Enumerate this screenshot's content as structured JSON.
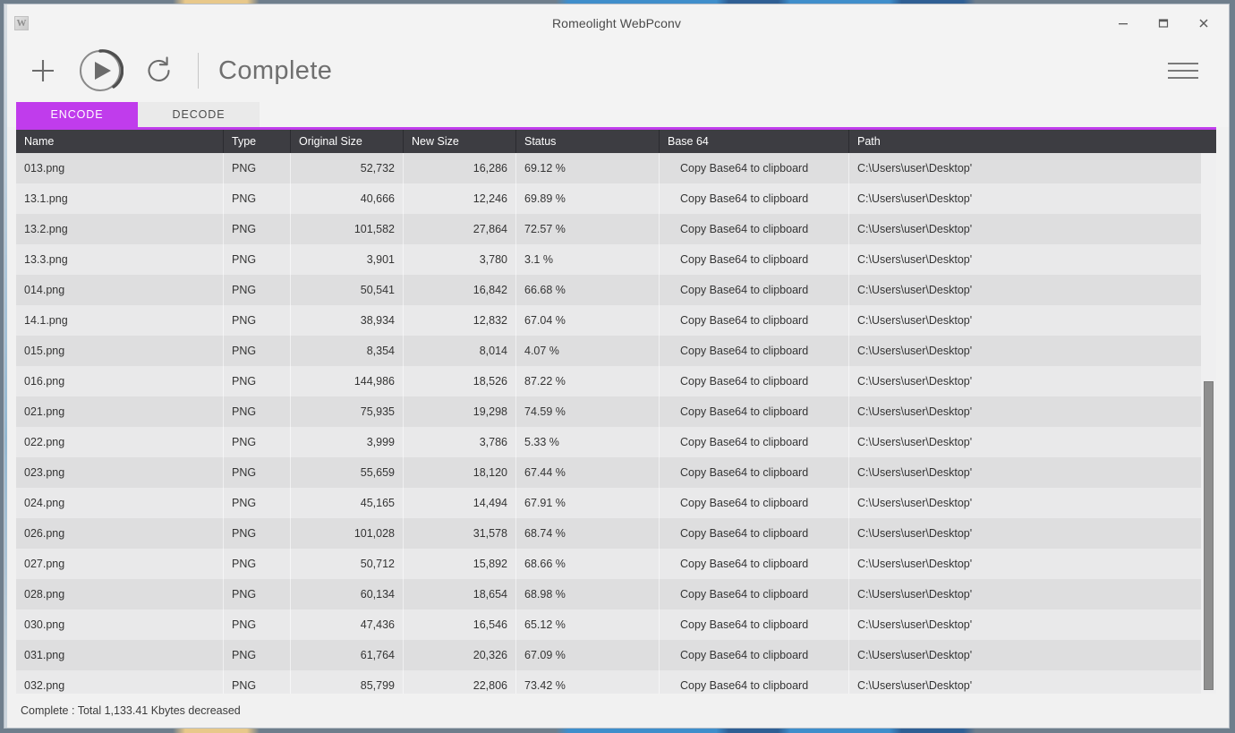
{
  "window": {
    "title": "Romeolight WebPconv",
    "app_icon": "W",
    "controls": {
      "minimize": "minimize-icon",
      "maximize": "maximize-icon",
      "close": "close-icon"
    }
  },
  "toolbar": {
    "add_label": "add-icon",
    "start_label": "play-icon",
    "refresh_label": "refresh-icon",
    "status": "Complete",
    "menu_label": "hamburger-icon"
  },
  "tabs": [
    {
      "label": "ENCODE",
      "active": true
    },
    {
      "label": "DECODE",
      "active": false
    }
  ],
  "table": {
    "columns": [
      {
        "key": "name",
        "label": "Name"
      },
      {
        "key": "type",
        "label": "Type"
      },
      {
        "key": "orig",
        "label": "Original Size"
      },
      {
        "key": "new",
        "label": "New Size"
      },
      {
        "key": "status",
        "label": "Status"
      },
      {
        "key": "b64",
        "label": "Base 64"
      },
      {
        "key": "path",
        "label": "Path"
      }
    ],
    "rows": [
      {
        "name": "013.png",
        "type": "PNG",
        "orig": "52,732",
        "new": "16,286",
        "status": "69.12 %",
        "b64": "Copy Base64 to clipboard",
        "path": "C:\\Users\\user\\Desktop'"
      },
      {
        "name": "13.1.png",
        "type": "PNG",
        "orig": "40,666",
        "new": "12,246",
        "status": "69.89 %",
        "b64": "Copy Base64 to clipboard",
        "path": "C:\\Users\\user\\Desktop'"
      },
      {
        "name": "13.2.png",
        "type": "PNG",
        "orig": "101,582",
        "new": "27,864",
        "status": "72.57 %",
        "b64": "Copy Base64 to clipboard",
        "path": "C:\\Users\\user\\Desktop'"
      },
      {
        "name": "13.3.png",
        "type": "PNG",
        "orig": "3,901",
        "new": "3,780",
        "status": "3.1 %",
        "b64": "Copy Base64 to clipboard",
        "path": "C:\\Users\\user\\Desktop'"
      },
      {
        "name": "014.png",
        "type": "PNG",
        "orig": "50,541",
        "new": "16,842",
        "status": "66.68 %",
        "b64": "Copy Base64 to clipboard",
        "path": "C:\\Users\\user\\Desktop'"
      },
      {
        "name": "14.1.png",
        "type": "PNG",
        "orig": "38,934",
        "new": "12,832",
        "status": "67.04 %",
        "b64": "Copy Base64 to clipboard",
        "path": "C:\\Users\\user\\Desktop'"
      },
      {
        "name": "015.png",
        "type": "PNG",
        "orig": "8,354",
        "new": "8,014",
        "status": "4.07 %",
        "b64": "Copy Base64 to clipboard",
        "path": "C:\\Users\\user\\Desktop'"
      },
      {
        "name": "016.png",
        "type": "PNG",
        "orig": "144,986",
        "new": "18,526",
        "status": "87.22 %",
        "b64": "Copy Base64 to clipboard",
        "path": "C:\\Users\\user\\Desktop'"
      },
      {
        "name": "021.png",
        "type": "PNG",
        "orig": "75,935",
        "new": "19,298",
        "status": "74.59 %",
        "b64": "Copy Base64 to clipboard",
        "path": "C:\\Users\\user\\Desktop'"
      },
      {
        "name": "022.png",
        "type": "PNG",
        "orig": "3,999",
        "new": "3,786",
        "status": "5.33 %",
        "b64": "Copy Base64 to clipboard",
        "path": "C:\\Users\\user\\Desktop'"
      },
      {
        "name": "023.png",
        "type": "PNG",
        "orig": "55,659",
        "new": "18,120",
        "status": "67.44 %",
        "b64": "Copy Base64 to clipboard",
        "path": "C:\\Users\\user\\Desktop'"
      },
      {
        "name": "024.png",
        "type": "PNG",
        "orig": "45,165",
        "new": "14,494",
        "status": "67.91 %",
        "b64": "Copy Base64 to clipboard",
        "path": "C:\\Users\\user\\Desktop'"
      },
      {
        "name": "026.png",
        "type": "PNG",
        "orig": "101,028",
        "new": "31,578",
        "status": "68.74 %",
        "b64": "Copy Base64 to clipboard",
        "path": "C:\\Users\\user\\Desktop'"
      },
      {
        "name": "027.png",
        "type": "PNG",
        "orig": "50,712",
        "new": "15,892",
        "status": "68.66 %",
        "b64": "Copy Base64 to clipboard",
        "path": "C:\\Users\\user\\Desktop'"
      },
      {
        "name": "028.png",
        "type": "PNG",
        "orig": "60,134",
        "new": "18,654",
        "status": "68.98 %",
        "b64": "Copy Base64 to clipboard",
        "path": "C:\\Users\\user\\Desktop'"
      },
      {
        "name": "030.png",
        "type": "PNG",
        "orig": "47,436",
        "new": "16,546",
        "status": "65.12 %",
        "b64": "Copy Base64 to clipboard",
        "path": "C:\\Users\\user\\Desktop'"
      },
      {
        "name": "031.png",
        "type": "PNG",
        "orig": "61,764",
        "new": "20,326",
        "status": "67.09 %",
        "b64": "Copy Base64 to clipboard",
        "path": "C:\\Users\\user\\Desktop'"
      },
      {
        "name": "032.png",
        "type": "PNG",
        "orig": "85,799",
        "new": "22,806",
        "status": "73.42 %",
        "b64": "Copy Base64 to clipboard",
        "path": "C:\\Users\\user\\Desktop'"
      }
    ]
  },
  "statusbar": {
    "text": "Complete : Total 1,133.41 Kbytes decreased"
  },
  "colors": {
    "accent": "#c03cec",
    "header_bg": "#3d3d42",
    "row_odd": "#dededf",
    "row_even": "#e9e9ea",
    "window_bg": "#f1f1f1"
  }
}
